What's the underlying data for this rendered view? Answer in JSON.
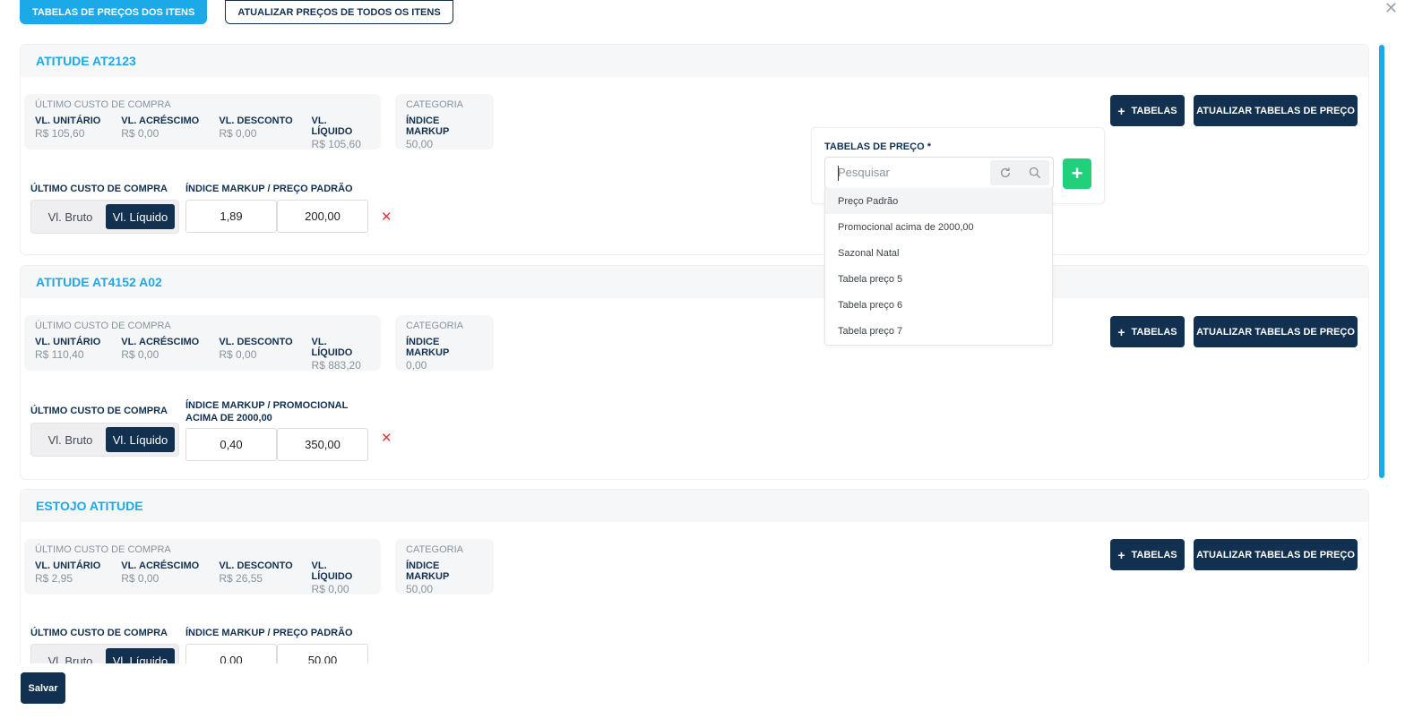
{
  "top_tabs": {
    "price_tables": "TABELAS DE PREÇOS DOS ITENS",
    "update_all": "ATUALIZAR PREÇOS DE TODOS OS ITENS"
  },
  "close_glyph": "✕",
  "labels": {
    "last_cost": "ÚLTIMO CUSTO DE COMPRA",
    "unit": "VL. UNITÁRIO",
    "increase": "VL. ACRÉSCIMO",
    "discount": "VL. DESCONTO",
    "net": "VL. LÍQUIDO",
    "category": "CATEGORIA",
    "markup_index": "ÍNDICE MARKUP",
    "gross_toggle": "Vl. Bruto",
    "net_toggle": "Vl. Líquido",
    "add_tables": "TABELAS",
    "update_tables": "ATUALIZAR TABELAS DE PREÇO"
  },
  "items": [
    {
      "title": "ATITUDE AT2123",
      "unit": "R$ 105,60",
      "increase": "R$ 0,00",
      "discount": "R$ 0,00",
      "net": "R$ 105,60",
      "markup": "50,00",
      "markup_label": "ÍNDICE MARKUP / PREÇO PADRÃO",
      "index_value": "1,89",
      "price_value": "200,00"
    },
    {
      "title": "ATITUDE AT4152 A02",
      "unit": "R$ 110,40",
      "increase": "R$ 0,00",
      "discount": "R$ 0,00",
      "net": "R$ 883,20",
      "markup": "0,00",
      "markup_label": "ÍNDICE MARKUP / PROMOCIONAL ACIMA DE 2000,00",
      "index_value": "0,40",
      "price_value": "350,00"
    },
    {
      "title": "ESTOJO ATITUDE",
      "unit": "R$ 2,95",
      "increase": "R$ 0,00",
      "discount": "R$ 26,55",
      "net": "R$ 0,00",
      "markup": "50,00",
      "markup_label": "ÍNDICE MARKUP / PREÇO PADRÃO",
      "index_value": "0,00",
      "price_value": "50,00"
    }
  ],
  "popover": {
    "label": "TABELAS DE PREÇO *",
    "search_placeholder": "Pesquisar",
    "options": [
      "Preço Padrão",
      "Promocional acima de 2000,00",
      "Sazonal Natal",
      "Tabela preço 5",
      "Tabela preço 6",
      "Tabela preço 7"
    ]
  },
  "save_label": "Salvar"
}
